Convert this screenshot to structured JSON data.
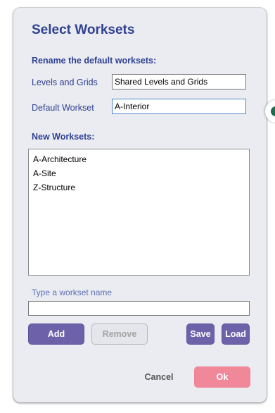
{
  "dialog": {
    "title": "Select Worksets",
    "rename_section_label": "Rename the default worksets:",
    "levels_label": "Levels and Grids",
    "levels_value": "Shared Levels and Grids",
    "default_workset_label": "Default Workset",
    "default_workset_value": "A-Interior",
    "new_worksets_label": "New Worksets:",
    "new_worksets": [
      "A-Architecture",
      "A-Site",
      "Z-Structure"
    ],
    "workset_name_label": "Type a workset name",
    "workset_name_value": "",
    "buttons": {
      "add": "Add",
      "remove": "Remove",
      "save": "Save",
      "load": "Load",
      "cancel": "Cancel",
      "ok": "Ok"
    }
  },
  "colors": {
    "accent": "#2f4192",
    "primary_button": "#6d62aa",
    "ok_button": "#f1889a",
    "dialog_background": "#ebecf1"
  }
}
